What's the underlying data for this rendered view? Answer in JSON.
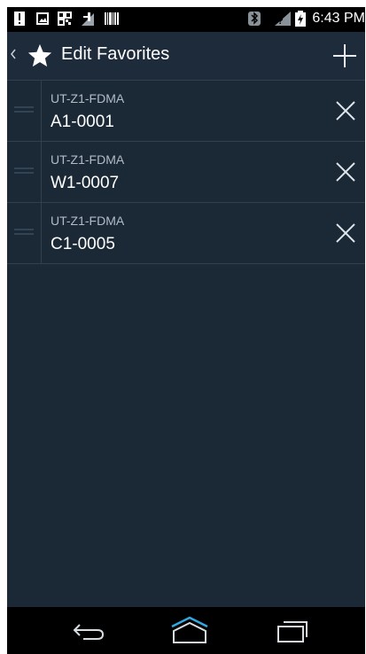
{
  "status_bar": {
    "time": "6:43 PM",
    "icons": [
      "alert-icon",
      "image-icon",
      "qr-icon",
      "signal-icon",
      "barcode-icon",
      "bluetooth-icon",
      "no-signal-icon",
      "battery-charging-icon"
    ]
  },
  "action_bar": {
    "title": "Edit Favorites",
    "icons": [
      "chevron-left-icon",
      "star-icon",
      "plus-icon"
    ]
  },
  "favorites": [
    {
      "group": "UT-Z1-FDMA",
      "name": "A1-0001"
    },
    {
      "group": "UT-Z1-FDMA",
      "name": "W1-0007"
    },
    {
      "group": "UT-Z1-FDMA",
      "name": "C1-0005"
    }
  ],
  "nav_bar": {
    "icons": [
      "back-icon",
      "home-icon",
      "recents-icon"
    ]
  },
  "colors": {
    "background": "#1b2836",
    "action_bar": "#1e2b3a",
    "divider": "#2f4050",
    "secondary_text": "#b2bcc6",
    "system_bar": "#000000"
  }
}
